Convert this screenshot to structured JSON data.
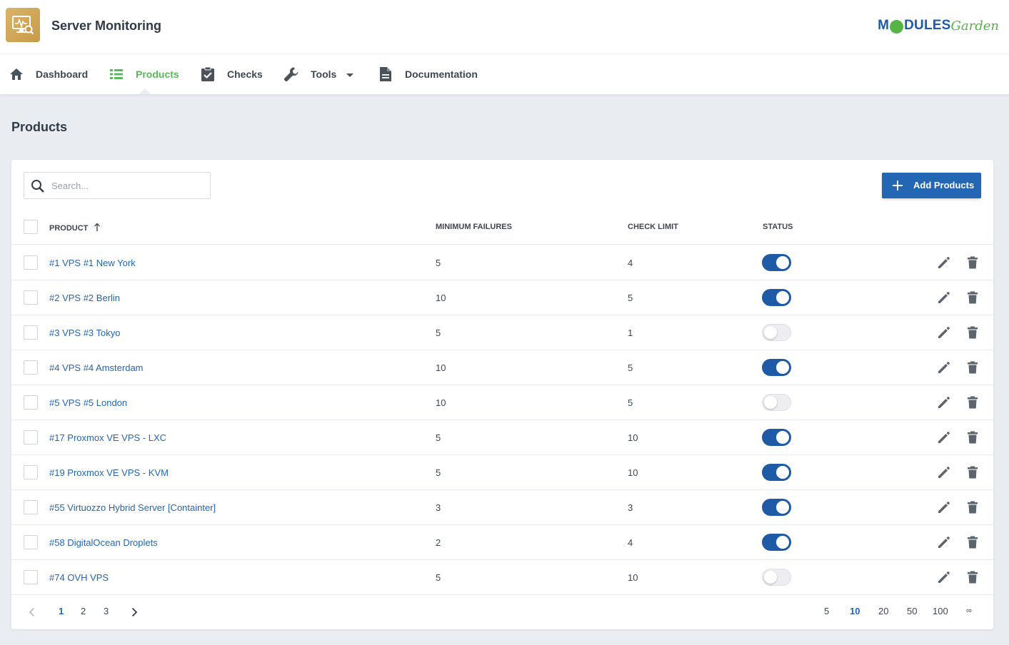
{
  "header": {
    "app_title": "Server Monitoring",
    "app_icon": "monitor-search-icon",
    "brand_modules_left": "M",
    "brand_modules_right": "DULES",
    "brand_garden": "Garden",
    "colors": {
      "brand_blue": "#1e5aa8",
      "brand_green": "#56b447"
    }
  },
  "nav": {
    "items": [
      {
        "label": "Dashboard",
        "icon": "home-icon"
      },
      {
        "label": "Products",
        "icon": "list-icon",
        "active": true
      },
      {
        "label": "Checks",
        "icon": "clipboard-check-icon"
      },
      {
        "label": "Tools",
        "icon": "wrench-icon",
        "dropdown": true
      },
      {
        "label": "Documentation",
        "icon": "document-icon"
      }
    ],
    "active_color": "#5cb85c"
  },
  "page": {
    "title": "Products"
  },
  "search": {
    "placeholder": "Search...",
    "value": ""
  },
  "toolbar": {
    "add_label": "Add Products"
  },
  "table": {
    "columns": {
      "product": "Product",
      "min_failures": "Minimum Failures",
      "check_limit": "Check Limit",
      "status": "Status"
    },
    "sort": {
      "column": "product",
      "direction": "asc"
    },
    "rows": [
      {
        "product": "#1 VPS #1 New York",
        "min_failures": "5",
        "check_limit": "4",
        "status": true
      },
      {
        "product": "#2 VPS #2 Berlin",
        "min_failures": "10",
        "check_limit": "5",
        "status": true
      },
      {
        "product": "#3 VPS #3 Tokyo",
        "min_failures": "5",
        "check_limit": "1",
        "status": false
      },
      {
        "product": "#4 VPS #4 Amsterdam",
        "min_failures": "10",
        "check_limit": "5",
        "status": true
      },
      {
        "product": "#5 VPS #5 London",
        "min_failures": "10",
        "check_limit": "5",
        "status": false
      },
      {
        "product": "#17 Proxmox VE VPS - LXC",
        "min_failures": "5",
        "check_limit": "10",
        "status": true
      },
      {
        "product": "#19 Proxmox VE VPS - KVM",
        "min_failures": "5",
        "check_limit": "10",
        "status": true
      },
      {
        "product": "#55 Virtuozzo Hybrid Server [Containter]",
        "min_failures": "3",
        "check_limit": "3",
        "status": true
      },
      {
        "product": "#58 DigitalOcean Droplets",
        "min_failures": "2",
        "check_limit": "4",
        "status": true
      },
      {
        "product": "#74 OVH VPS",
        "min_failures": "5",
        "check_limit": "10",
        "status": false
      }
    ]
  },
  "pagination": {
    "pages": [
      "1",
      "2",
      "3"
    ],
    "current_page": "1",
    "page_sizes": [
      "5",
      "10",
      "20",
      "50",
      "100",
      "∞"
    ],
    "current_size": "10"
  },
  "colors": {
    "primary": "#2366b4",
    "toggle_on": "#1f5aa6",
    "link": "#2366b4"
  }
}
